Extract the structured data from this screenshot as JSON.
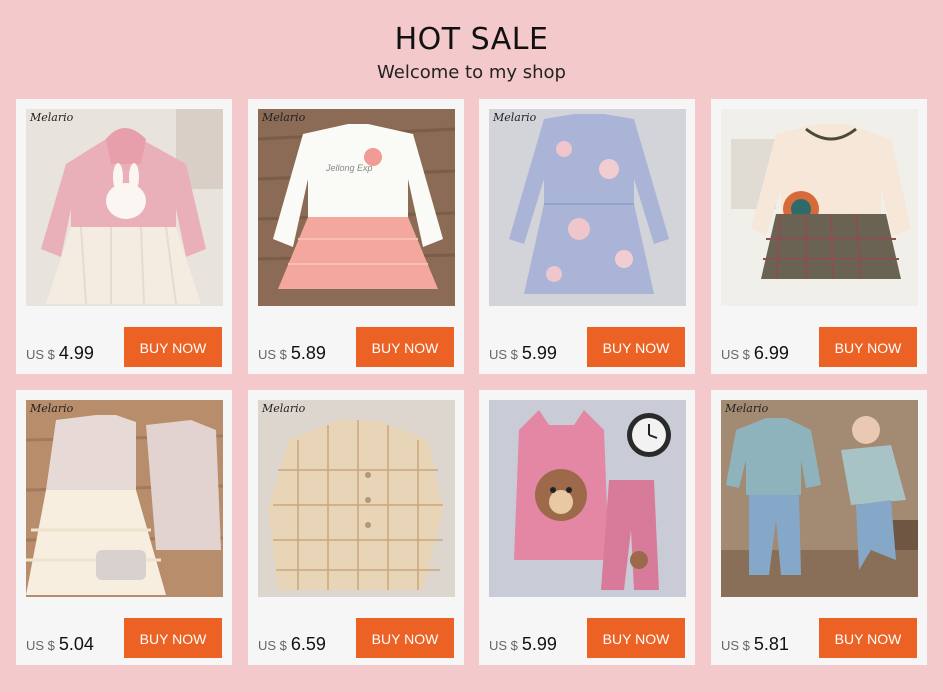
{
  "header": {
    "title": "HOT SALE",
    "subtitle": "Welcome to my shop"
  },
  "products": [
    {
      "brand": "Melario",
      "currency": "US $",
      "price": "4.99",
      "button": "BUY NOW",
      "image": "pink-hoodie-tulle-dress"
    },
    {
      "brand": "Melario",
      "currency": "US $",
      "price": "5.89",
      "button": "BUY NOW",
      "image": "white-top-pink-tulle-skirt"
    },
    {
      "brand": "Melario",
      "currency": "US $",
      "price": "5.99",
      "button": "BUY NOW",
      "image": "blue-floral-dress"
    },
    {
      "brand": "",
      "currency": "US $",
      "price": "6.99",
      "button": "BUY NOW",
      "image": "cream-top-plaid-skirt"
    },
    {
      "brand": "Melario",
      "currency": "US $",
      "price": "5.04",
      "button": "BUY NOW",
      "image": "tweed-tulle-dress-set"
    },
    {
      "brand": "Melario",
      "currency": "US $",
      "price": "6.59",
      "button": "BUY NOW",
      "image": "beige-plaid-coat-set"
    },
    {
      "brand": "",
      "currency": "US $",
      "price": "5.99",
      "button": "BUY NOW",
      "image": "pink-bear-hoodie-set"
    },
    {
      "brand": "Melario",
      "currency": "US $",
      "price": "5.81",
      "button": "BUY NOW",
      "image": "teal-sweatshirt-jeans-set"
    }
  ],
  "colors": {
    "background": "#f4c9cb",
    "card": "#f6f6f6",
    "button": "#ec6225"
  }
}
